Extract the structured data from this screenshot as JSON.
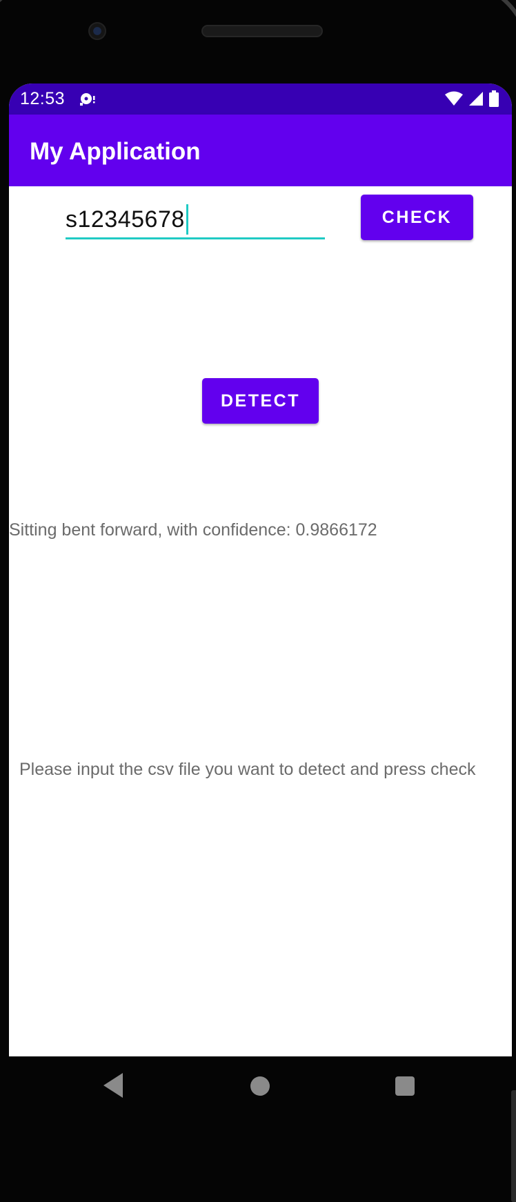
{
  "status_bar": {
    "time": "12:53",
    "icons": [
      "notification-disc-icon",
      "wifi-icon",
      "cell-signal-icon",
      "battery-icon"
    ]
  },
  "app_bar": {
    "title": "My Application"
  },
  "input": {
    "value": "s12345678"
  },
  "buttons": {
    "check_label": "CHECK",
    "detect_label": "DETECT"
  },
  "result_text": "Sitting bent forward, with confidence: 0.9866172",
  "hint_text": "Please input the csv file you want to detect and press check",
  "colors": {
    "status_bar": "#3700b3",
    "primary": "#6200ee",
    "accent": "#1fcac4",
    "secondary_text": "#6b6b6b"
  },
  "nav_bar": {
    "icons": [
      "back-icon",
      "home-icon",
      "recents-icon"
    ]
  }
}
